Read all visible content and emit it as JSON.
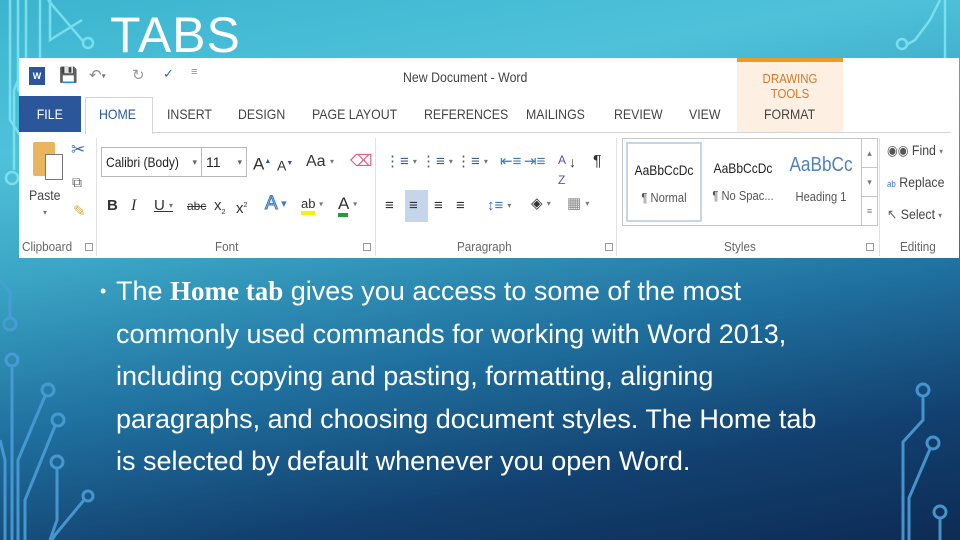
{
  "slide": {
    "title": "TABS",
    "body_prefix": "The ",
    "body_emphasis": "Home tab",
    "body_suffix": " gives you access to some of the most commonly used commands for working with Word 2013, including copying and pasting, formatting, aligning paragraphs, and choosing document styles. The Home tab is selected by default whenever you open Word.",
    "bullet": "•"
  },
  "colors": {
    "file_tab": "#2b579a",
    "contextual_accent": "#f09a22",
    "background_top": "#4fc2da",
    "background_bottom": "#0d2b55"
  },
  "word": {
    "window_title": "New Document - Word",
    "quick_access": [
      "word-logo",
      "save",
      "undo",
      "redo",
      "spelling",
      "customize"
    ],
    "contextual_group": "DRAWING TOOLS",
    "tabs": [
      {
        "label": "FILE"
      },
      {
        "label": "HOME",
        "selected": true
      },
      {
        "label": "INSERT"
      },
      {
        "label": "DESIGN"
      },
      {
        "label": "PAGE LAYOUT"
      },
      {
        "label": "REFERENCES"
      },
      {
        "label": "MAILINGS"
      },
      {
        "label": "REVIEW"
      },
      {
        "label": "VIEW"
      },
      {
        "label": "FORMAT"
      }
    ],
    "groups": {
      "clipboard": {
        "label": "Clipboard",
        "paste": "Paste"
      },
      "font": {
        "label": "Font",
        "font_name": "Calibri (Body)",
        "font_size": "11",
        "change_case": "Aa"
      },
      "paragraph": {
        "label": "Paragraph"
      },
      "styles": {
        "label": "Styles",
        "items": [
          {
            "preview": "AaBbCcDc",
            "name": "¶ Normal",
            "selected": true
          },
          {
            "preview": "AaBbCcDc",
            "name": "¶ No Spac..."
          },
          {
            "preview": "AaBbCc",
            "name": "Heading 1"
          }
        ]
      },
      "editing": {
        "label": "Editing",
        "find": "Find",
        "replace": "Replace",
        "select": "Select"
      }
    }
  }
}
